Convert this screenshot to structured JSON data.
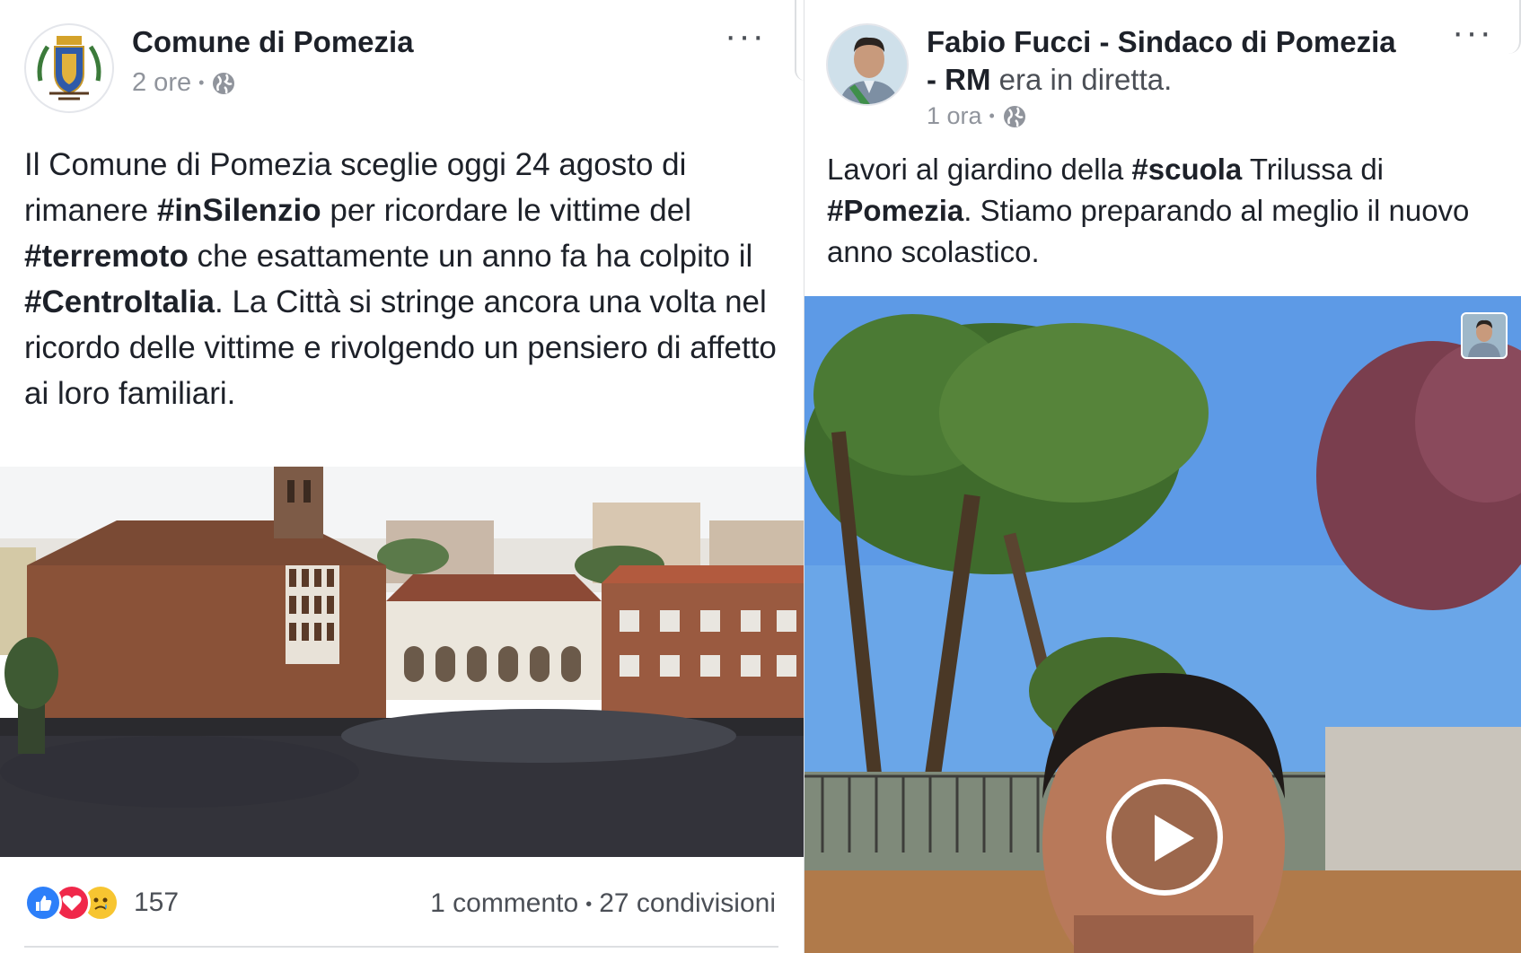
{
  "left_post": {
    "page_name": "Comune di Pomezia",
    "time": "2 ore",
    "text_parts": [
      {
        "t": "Il Comune di Pomezia sceglie oggi 24 agosto di rimanere ",
        "b": false
      },
      {
        "t": "#inSilenzio",
        "b": true
      },
      {
        "t": " per ricordare le vittime del ",
        "b": false
      },
      {
        "t": "#terremoto",
        "b": true
      },
      {
        "t": " che esattamente un anno fa ha colpito il ",
        "b": false
      },
      {
        "t": "#CentroItalia",
        "b": true
      },
      {
        "t": ". La Città si stringe ancora una volta nel ricordo delle vittime e rivolgendo un pensiero di affetto ai loro familiari.",
        "b": false
      }
    ],
    "reactions": {
      "icons": [
        "like-icon",
        "love-icon",
        "sad-icon"
      ],
      "count": "157"
    },
    "comments": "1 commento",
    "shares": "27 condivisioni"
  },
  "right_post": {
    "author_name": "Fabio Fucci - Sindaco di Pomezia - RM",
    "live_suffix": "era in diretta.",
    "time": "1 ora",
    "text_parts": [
      {
        "t": "Lavori al giardino della ",
        "b": false
      },
      {
        "t": "#scuola",
        "b": true
      },
      {
        "t": " Trilussa di ",
        "b": false
      },
      {
        "t": "#Pomezia",
        "b": true
      },
      {
        "t": ". Stiamo preparando al meglio il nuovo anno scolastico.",
        "b": false
      }
    ]
  },
  "separator": "•",
  "more_label": "···",
  "colors": {
    "like": "#2d7ff9",
    "love": "#f0284a",
    "sad": "#f7c531",
    "sky": "#6aa6e8"
  }
}
